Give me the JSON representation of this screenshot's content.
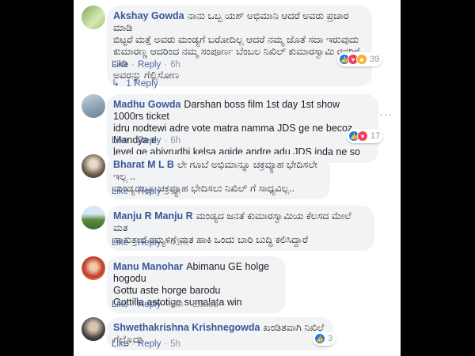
{
  "colors": {
    "link": "#385898",
    "bubble": "#f2f3f5",
    "meta": "#90949c",
    "like_blue": "#1877f2",
    "love_red": "#f33e58",
    "haha_yellow": "#f7b125"
  },
  "comments": [
    {
      "author": "Akshay Gowda",
      "text": "ನಾನು ಒಬ್ಬ ಯಶ್ ಅಭಿಮಾನಿ ಆದರೆ ಅವರು ಪ್ರಚಾರ ಮಾಡಿ\nಬಿಟ್ಟರೆ ಮತ್ತೆ ಅವರು ಮಂಡ್ಯಗೆ ಬರೋದಿಲ್ಲ ಆದರೆ ನಮ್ಮ ಜೊತೆ ಸದಾ ಇರುವುದು\nಕುಮಾರಣ್ಣ ಆದರಿಂದ ನಮ್ಮ ಸಂಪೂರ್ಣ ಬೆಂಬಲ ನಿಖಿಲ್ ಕುಮಾರಸ್ವಾಮಿ ರವರಿಗೆ ನೀಡಿ\nಅವರನ್ನು ಗೆಲ್ಲಿಸೋಣ",
      "like": "Like",
      "reply": "Reply",
      "time": "6h",
      "reactions": {
        "count": "39",
        "icons": [
          "like-icon",
          "love-icon",
          "haha-icon"
        ]
      },
      "replies_label": "1 Reply"
    },
    {
      "author": "Madhu Gowda",
      "text": "Darshan boss film 1st day 1st show 1000rs ticket\nidru nodtewi adre vote matra namma JDS ge ne becoz Mandya e\nlevel ge abivrudhi kelsa agide andre adu JDS inda ne so",
      "like": "Like",
      "reply": "Reply",
      "time": "6h",
      "reactions": {
        "count": "17",
        "icons": [
          "like-icon",
          "love-icon"
        ]
      },
      "more": "···"
    },
    {
      "author": "Bharat M L B",
      "text": "ಲೇ ಗೂಬೆ ಅಭಿಮಾನ್ನೂ ಚಕ್ರವ್ಯೂಹ ಭೇದಿಸಲೇ ಇಲ್ಲ ..\nಮಂಡ್ಯದಲ್ಲೂ ಚಕ್ರವ್ಯೂಹ ಭೇದಿಸಲು ನಿಖಿಲ್ ಗೆ ಸಾಧ್ಯವಿಲ್ಲ..",
      "like": "Like",
      "reply": "Reply",
      "time": "1h"
    },
    {
      "author": "Manju R Manju R",
      "text": "ಮಂಡ್ಯದ ಜನತೆ ಕುಮಾರಸ್ವಾಮಿಯ ಕೆಲಸದ ಮೇಲೆ ಮತ\nಹಾಕುತ್ತಾರೆ ರಮ್ಯಳಿಗೆ ಮತ ಹಾಕಿ ಒಂದು ಬಾರಿ ಬುದ್ಧಿ ಕಲಿಸಿದ್ದಾರೆ",
      "like": "Like",
      "reply": "Reply",
      "time": "41m"
    },
    {
      "author": "Manu Manohar",
      "text": "Abimanu GE holge hogodu\nGottu aste horge barodu\nGottilla astotige sumalata win",
      "like": "Like",
      "reply": "Reply",
      "time": "8m",
      "edited": "Edited"
    },
    {
      "author": "Shwethakrishna Krishnegowda",
      "text": "ಖಂಡಿತವಾಗಿ ನಿಖಿಲ್ದೆ ಗೆಲ್ತೊದು",
      "like": "Like",
      "reply": "Reply",
      "time": "5h",
      "reactions": {
        "count": "3",
        "icons": [
          "like-icon"
        ]
      }
    }
  ]
}
